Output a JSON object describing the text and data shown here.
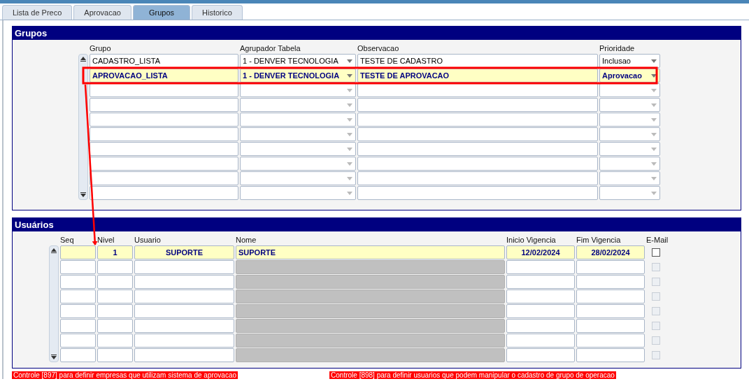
{
  "tabs": [
    {
      "label": "Lista de Preco",
      "selected": false
    },
    {
      "label": "Aprovacao",
      "selected": false
    },
    {
      "label": "Grupos",
      "selected": true
    },
    {
      "label": "Historico",
      "selected": false
    }
  ],
  "grupos": {
    "title": "Grupos",
    "columns": [
      "Grupo",
      "Agrupador Tabela",
      "Observacao",
      "Prioridade"
    ],
    "rows": [
      {
        "selected": false,
        "grupo": "CADASTRO_LISTA",
        "agrupador": "1 - DENVER TECNOLOGIA",
        "observacao": "TESTE DE CADASTRO",
        "prioridade": "Inclusao",
        "disabled": false
      },
      {
        "selected": true,
        "grupo": "APROVACAO_LISTA",
        "agrupador": "1 - DENVER TECNOLOGIA",
        "observacao": "TESTE DE APROVACAO",
        "prioridade": "Aprovacao",
        "disabled": false
      },
      {
        "selected": false,
        "disabled": true
      },
      {
        "selected": false,
        "disabled": true
      },
      {
        "selected": false,
        "disabled": true
      },
      {
        "selected": false,
        "disabled": true
      },
      {
        "selected": false,
        "disabled": true
      },
      {
        "selected": false,
        "disabled": true
      },
      {
        "selected": false,
        "disabled": true
      },
      {
        "selected": false,
        "disabled": true
      }
    ]
  },
  "usuarios": {
    "title": "Usuários",
    "columns": [
      "Seq",
      "Nivel",
      "Usuario",
      "Nome",
      "Inicio Vigencia",
      "Fim Vigencia",
      "E-Mail"
    ],
    "rows": [
      {
        "selected": true,
        "nivel": "1",
        "usuario": "SUPORTE",
        "nome": "SUPORTE",
        "inicio": "12/02/2024",
        "fim": "28/02/2024",
        "nome_disabled": false,
        "email_checked": false,
        "email_disabled": false
      },
      {
        "selected": false,
        "nome_disabled": true,
        "email_checked": false,
        "email_disabled": true
      },
      {
        "selected": false,
        "nome_disabled": true,
        "email_checked": false,
        "email_disabled": true
      },
      {
        "selected": false,
        "nome_disabled": true,
        "email_checked": false,
        "email_disabled": true
      },
      {
        "selected": false,
        "nome_disabled": true,
        "email_checked": false,
        "email_disabled": true
      },
      {
        "selected": false,
        "nome_disabled": true,
        "email_checked": false,
        "email_disabled": true
      },
      {
        "selected": false,
        "nome_disabled": true,
        "email_checked": false,
        "email_disabled": true
      },
      {
        "selected": false,
        "nome_disabled": true,
        "email_checked": false,
        "email_disabled": true
      }
    ]
  },
  "notes": [
    "Controle [897] para definir empresas que utilizam sistema de aprovacao",
    "Controle [898] para definir usuarios que podem manipular o cadastro de grupo de operacao"
  ],
  "annotations": {
    "highlight_box": true,
    "arrow": true
  }
}
